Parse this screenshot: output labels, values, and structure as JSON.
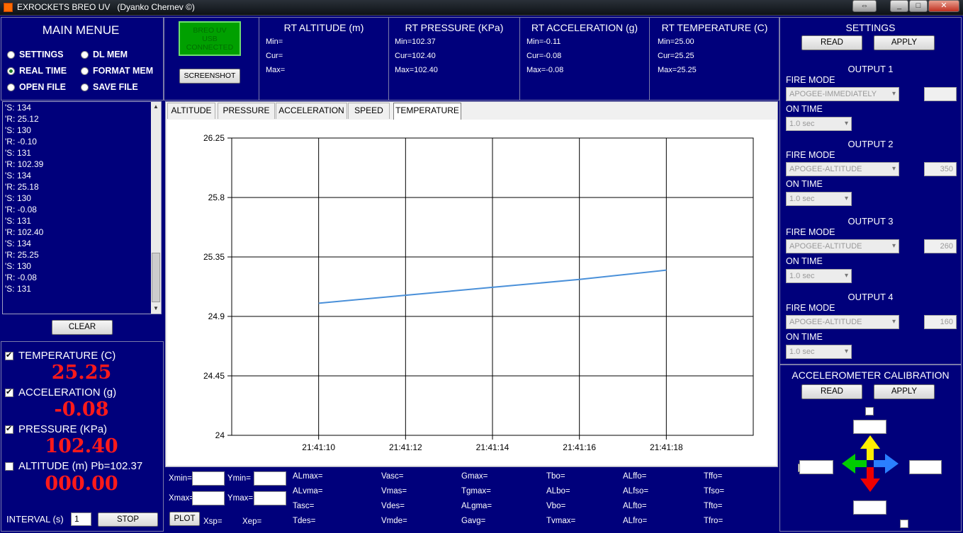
{
  "window": {
    "title": "EXROCKETS BREO UV   (Dyanko Chernev ©)",
    "buttons": {
      "restore": "⇔",
      "minimize": "_",
      "maximize": "□",
      "close": "✕"
    }
  },
  "main_menu": {
    "title": "MAIN MENUE",
    "options": [
      {
        "label": "SETTINGS",
        "selected": false
      },
      {
        "label": "DL MEM",
        "selected": false
      },
      {
        "label": "REAL TIME",
        "selected": true
      },
      {
        "label": "FORMAT MEM",
        "selected": false
      },
      {
        "label": "OPEN FILE",
        "selected": false
      },
      {
        "label": "SAVE FILE",
        "selected": false
      }
    ]
  },
  "log_lines": [
    "'S: 134",
    "'R: 25.12",
    "'S: 130",
    "'R: -0.10",
    "'S: 131",
    "'R: 102.39",
    "'S: 134",
    "'R: 25.18",
    "'S: 130",
    "'R: -0.08",
    "'S: 131",
    "'R: 102.40",
    "'S: 134",
    "'R: 25.25",
    "'S: 130",
    "'R: -0.08",
    "'S: 131"
  ],
  "clear_label": "CLEAR",
  "readouts": {
    "temperature": {
      "label": "TEMPERATURE (C)",
      "value": "25.25",
      "checked": true
    },
    "acceleration": {
      "label": "ACCELERATION (g)",
      "value": "-0.08",
      "checked": true
    },
    "pressure": {
      "label": "PRESSURE (KPa)",
      "value": "102.40",
      "checked": true
    },
    "altitude": {
      "label": "ALTITUDE (m) Pb=102.37",
      "value": "000.00",
      "checked": false
    }
  },
  "interval": {
    "label": "INTERVAL (s)",
    "value": "1",
    "stop_label": "STOP"
  },
  "status": {
    "usb_text": "BREO UV\nUSB\nCONNECTED",
    "usb_color": "#00a000",
    "screenshot_label": "SCREENSHOT"
  },
  "rt_panels": [
    {
      "title": "RT ALTITUDE (m)",
      "min": "Min=",
      "cur": "Cur=",
      "max": "Max="
    },
    {
      "title": "RT PRESSURE (KPa)",
      "min": "Min=102.37",
      "cur": "Cur=102.40",
      "max": "Max=102.40"
    },
    {
      "title": "RT ACCELERATION (g)",
      "min": "Min=-0.11",
      "cur": "Cur=-0.08",
      "max": "Max=-0.08"
    },
    {
      "title": "RT TEMPERATURE (C)",
      "min": "Min=25.00",
      "cur": "Cur=25.25",
      "max": "Max=25.25"
    }
  ],
  "tabs": [
    {
      "label": "ALTITUDE",
      "active": false
    },
    {
      "label": "PRESSURE",
      "active": false
    },
    {
      "label": "ACCELERATION",
      "active": false
    },
    {
      "label": "SPEED",
      "active": false
    },
    {
      "label": "TEMPERATURE",
      "active": true
    }
  ],
  "chart_data": {
    "type": "line",
    "title": "",
    "xlabel": "",
    "ylabel": "",
    "x": [
      "21:41:10",
      "21:41:12",
      "21:41:14",
      "21:41:16",
      "21:41:18"
    ],
    "x_seconds": [
      10,
      12,
      14,
      16,
      18
    ],
    "series": [
      {
        "values": [
          25.0,
          25.06,
          25.12,
          25.18,
          25.25
        ]
      }
    ],
    "ylim": [
      24,
      26.25
    ],
    "yticks": [
      "26.25",
      "25.8",
      "25.35",
      "24.9",
      "24.45",
      "24"
    ],
    "ytick_values": [
      26.25,
      25.8,
      25.35,
      24.9,
      24.45,
      24
    ],
    "xlim_seconds": [
      8,
      20
    ],
    "grid": true,
    "line_color": "#4a90d9"
  },
  "plot_controls": {
    "xmin": "Xmin=",
    "ymin": "Ymin=",
    "xmax": "Xmax=",
    "ymax": "Ymax=",
    "plot_label": "PLOT",
    "xsp": "Xsp=",
    "xep": "Xep="
  },
  "stats": [
    [
      "ALmax=",
      "ALvma=",
      "Tasc=",
      "Tdes="
    ],
    [
      "Vasc=",
      "Vmas=",
      "Vdes=",
      "Vmde="
    ],
    [
      "Gmax=",
      "Tgmax=",
      "ALgma=",
      "Gavg="
    ],
    [
      "Tbo=",
      "ALbo=",
      "Vbo=",
      "Tvmax="
    ],
    [
      "ALffo=",
      "ALfso=",
      "ALfto=",
      "ALfro="
    ],
    [
      "Tffo=",
      "Tfso=",
      "Tfto=",
      "Tfro="
    ]
  ],
  "settings": {
    "title": "SETTINGS",
    "read_label": "READ",
    "apply_label": "APPLY",
    "fire_mode_label": "FIRE MODE",
    "on_time_label": "ON TIME",
    "outputs": [
      {
        "title": "OUTPUT 1",
        "fire_mode": "APOGEE-IMMEDIATELY",
        "value": "",
        "on_time": "1.0 sec"
      },
      {
        "title": "OUTPUT 2",
        "fire_mode": "APOGEE-ALTITUDE",
        "value": "350",
        "on_time": "1.0 sec"
      },
      {
        "title": "OUTPUT 3",
        "fire_mode": "APOGEE-ALTITUDE",
        "value": "260",
        "on_time": "1.0 sec"
      },
      {
        "title": "OUTPUT 4",
        "fire_mode": "APOGEE-ALTITUDE",
        "value": "160",
        "on_time": "1.0 sec"
      }
    ]
  },
  "calibration": {
    "title": "ACCELEROMETER CALIBRATION",
    "read_label": "READ",
    "apply_label": "APPLY",
    "arrow_colors": {
      "up": "#ffee00",
      "left": "#00cc00",
      "right": "#2a7fff",
      "down": "#ee0000"
    }
  }
}
